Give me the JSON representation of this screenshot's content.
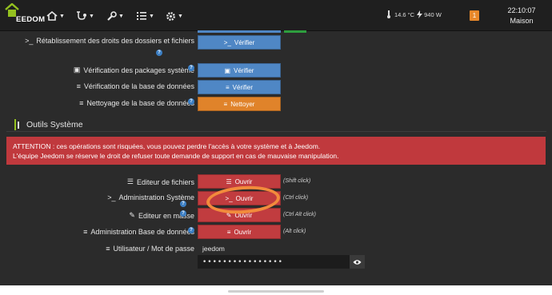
{
  "app": {
    "logo_text": "EEDOM"
  },
  "navbar": {
    "status": {
      "temperature": "14.6 °C",
      "power": "940 W"
    },
    "alert_count": "1",
    "clock": {
      "time": "22:10:07",
      "location": "Maison"
    }
  },
  "system_checks": {
    "permissions": {
      "label": "Rétablissement des droits des dossiers et fichiers",
      "button": "Vérifier"
    },
    "packages": {
      "label": "Vérification des packages système",
      "button": "Vérifier"
    },
    "database_check": {
      "label": "Vérification de la base de données",
      "button": "Vérifier"
    },
    "database_clean": {
      "label": "Nettoyage de la base de données",
      "button": "Nettoyer"
    }
  },
  "tools": {
    "title": "Outils Système",
    "warning_line1": "ATTENTION : ces opérations sont risquées, vous pouvez perdre l'accès à votre système et à Jeedom.",
    "warning_line2": "L'équipe Jeedom se réserve le droit de refuser toute demande de support en cas de mauvaise manipulation.",
    "file_editor": {
      "label": "Editeur de fichiers",
      "button": "Ouvrir",
      "hint": "(Shift click)"
    },
    "system_admin": {
      "label": "Administration Système",
      "button": "Ouvrir",
      "hint": "(Ctrl click)"
    },
    "mass_editor": {
      "label": "Editeur en masse",
      "button": "Ouvrir",
      "hint": "(Ctrl Alt click)"
    },
    "db_admin": {
      "label": "Administration Base de données",
      "button": "Ouvrir",
      "hint": "(Alt click)"
    },
    "credentials": {
      "label": "Utilisateur / Mot de passe",
      "username": "jeedom",
      "password_mask": "••••••••••••••••"
    }
  },
  "colors": {
    "accent_blue": "#4f87c5",
    "warning_red": "#c0393d",
    "clean_orange": "#e0832a",
    "annotation_orange": "#f28b3c"
  }
}
